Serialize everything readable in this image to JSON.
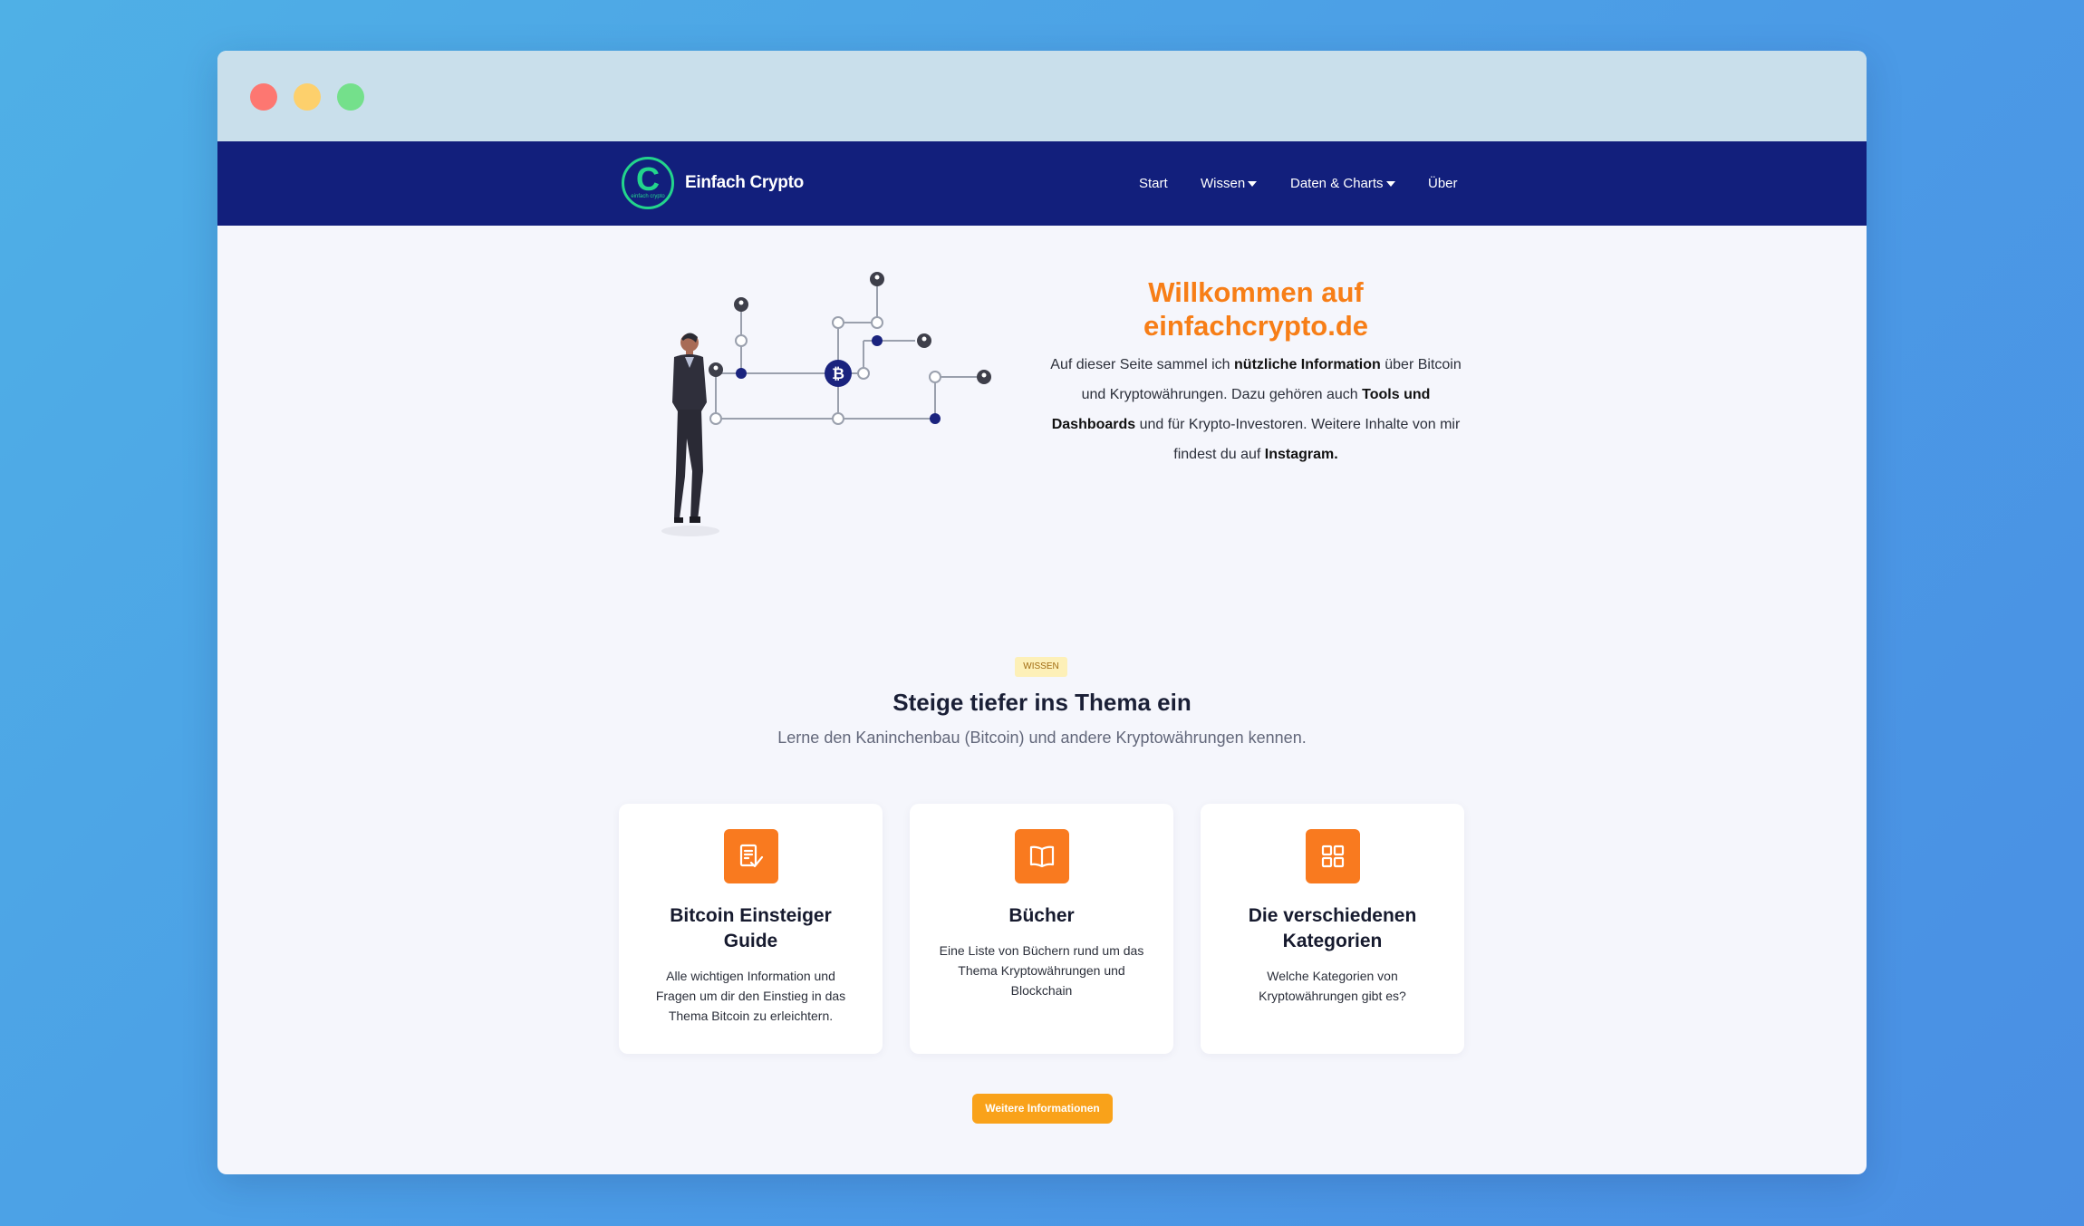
{
  "window": {
    "controls": [
      "close",
      "minimize",
      "maximize"
    ]
  },
  "navbar": {
    "brand": {
      "name": "Einfach Crypto",
      "logo_letter": "C",
      "logo_subtext": "einfach crypto"
    },
    "items": [
      {
        "label": "Start",
        "has_dropdown": false
      },
      {
        "label": "Wissen",
        "has_dropdown": true
      },
      {
        "label": "Daten & Charts",
        "has_dropdown": true
      },
      {
        "label": "Über",
        "has_dropdown": false
      }
    ]
  },
  "hero": {
    "title_line1": "Willkommen auf",
    "title_line2": "einfachcrypto.de",
    "description": {
      "t1": "Auf dieser Seite sammel ich ",
      "b1": "nützliche Information",
      "t2": " über Bitcoin und Kryptowährungen. Dazu gehören auch ",
      "b2": "Tools und Dashboards",
      "t3": " und für Krypto-Investoren. Weitere Inhalte von mir findest du auf ",
      "b3": "Instagram."
    }
  },
  "section": {
    "badge": "WISSEN",
    "title": "Steige tiefer ins Thema ein",
    "subtitle": "Lerne den Kaninchenbau (Bitcoin) und andere Kryptowährungen kennen."
  },
  "cards": [
    {
      "icon": "checklist-icon",
      "title": "Bitcoin Einsteiger Guide",
      "desc": "Alle wichtigen Information und Fragen um dir den Einstieg in das Thema Bitcoin zu erleichtern."
    },
    {
      "icon": "book-icon",
      "title": "Bücher",
      "desc": "Eine Liste von Büchern rund um das Thema Kryptowährungen und Blockchain"
    },
    {
      "icon": "grid-icon",
      "title": "Die verschiedenen Kategorien",
      "desc": "Welche Kategorien von Kryptowährungen gibt es?"
    }
  ],
  "cta": {
    "label": "Weitere Informationen"
  },
  "colors": {
    "navbar": "#121f7c",
    "accent_orange": "#f77e17",
    "icon_orange": "#f97a1f",
    "cta": "#f9a21a",
    "logo_green": "#23d48c",
    "page_bg": "#f5f6fc"
  }
}
